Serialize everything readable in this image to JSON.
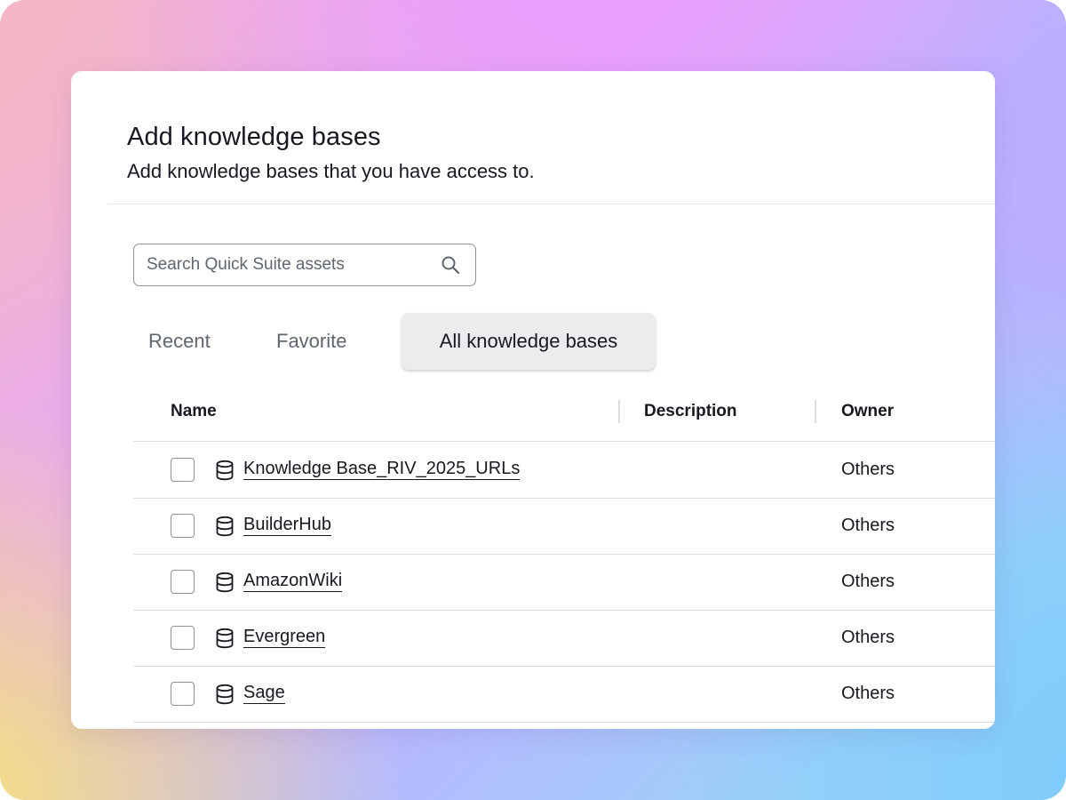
{
  "dialog": {
    "title": "Add knowledge bases",
    "subtitle": "Add knowledge bases that you have access to."
  },
  "search": {
    "placeholder": "Search Quick Suite assets",
    "value": "",
    "icon": "search-icon"
  },
  "tabs": [
    {
      "label": "Recent",
      "selected": false
    },
    {
      "label": "Favorite",
      "selected": false
    },
    {
      "label": "All knowledge bases",
      "selected": true
    }
  ],
  "table": {
    "columns": [
      "Name",
      "Description",
      "Owner"
    ],
    "rows": [
      {
        "name": "Knowledge Base_RIV_2025_URLs",
        "description": "",
        "owner": "Others",
        "checked": false,
        "icon": "database-icon"
      },
      {
        "name": "BuilderHub",
        "description": "",
        "owner": "Others",
        "checked": false,
        "icon": "database-icon"
      },
      {
        "name": "AmazonWiki",
        "description": "",
        "owner": "Others",
        "checked": false,
        "icon": "database-icon"
      },
      {
        "name": "Evergreen",
        "description": "",
        "owner": "Others",
        "checked": false,
        "icon": "database-icon"
      },
      {
        "name": "Sage",
        "description": "",
        "owner": "Others",
        "checked": false,
        "icon": "database-icon"
      }
    ]
  },
  "colors": {
    "text": "#16191f",
    "muted_text": "#5f6670",
    "selected_tab_bg": "#ececee",
    "border": "#8d9199",
    "divider": "#dadde2"
  }
}
